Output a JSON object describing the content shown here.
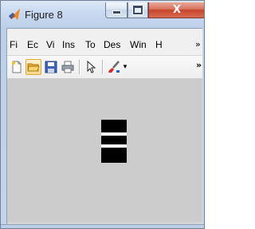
{
  "window": {
    "title": "Figure 8",
    "icons": {
      "app": "matlab-figure-icon",
      "minimize": "minimize-icon",
      "maximize": "maximize-icon",
      "close": "close-icon"
    },
    "close_glyph": "X"
  },
  "menubar": {
    "items": [
      "Fi",
      "Ec",
      "Vi",
      "Ins",
      "To",
      "Des",
      "Win",
      "H"
    ],
    "overflow_glyph": "»"
  },
  "toolbar": {
    "icons": [
      "new-file-icon",
      "open-folder-icon",
      "save-icon",
      "print-icon",
      "pointer-arrow-icon",
      "brush-icon"
    ],
    "dropdown_glyph": "▾",
    "overflow_glyph": "»"
  },
  "figure": {
    "background": "#cccccc",
    "block_color": "#000000",
    "stripe_color": "#ffffff",
    "stripe_count": 2
  }
}
